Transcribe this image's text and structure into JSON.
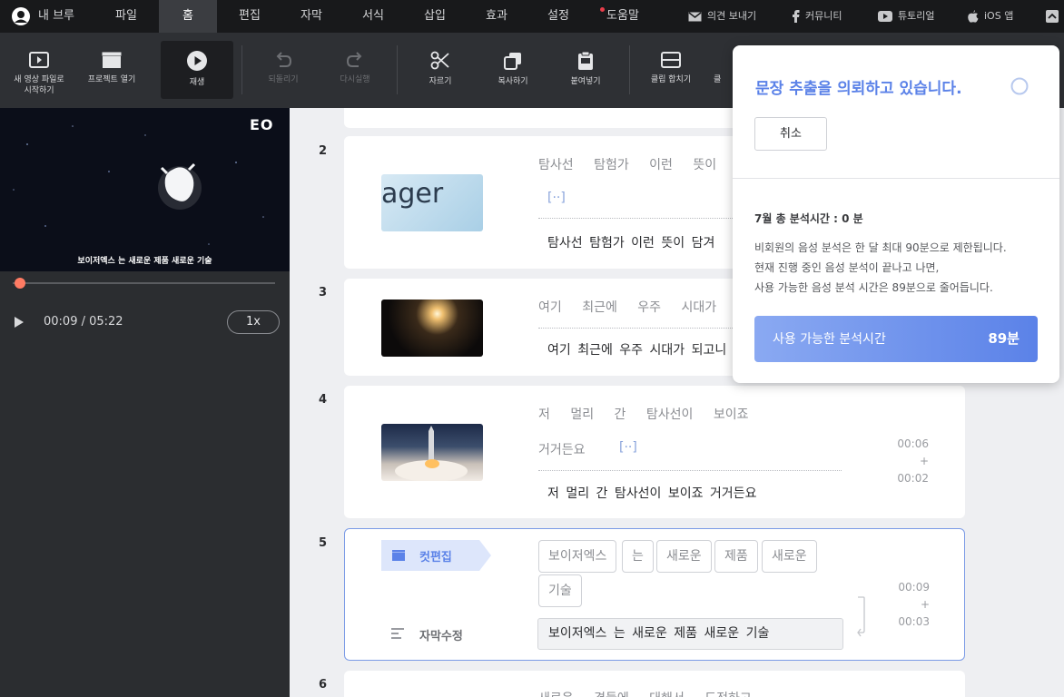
{
  "menu": {
    "user": "내 브루",
    "tabs": [
      "파일",
      "홈",
      "편집",
      "자막",
      "서식",
      "삽입",
      "효과",
      "설정",
      "도움말"
    ],
    "feedback": "의견 보내기",
    "community": "커뮤니티",
    "tutorial": "튜토리얼",
    "ios": "iOS 앱"
  },
  "toolbar": {
    "new_video": "새 영상 파일로\n시작하기",
    "open_project": "프로젝트 열기",
    "play": "재생",
    "undo": "되돌리기",
    "redo": "다시실행",
    "cut": "자르기",
    "copy": "복사하기",
    "paste": "붙여넣기",
    "merge": "클립 합치기",
    "split": "클"
  },
  "player": {
    "caption": "보이저엑스 는 새로운 제품 새로운 기술",
    "logo": "EO",
    "time": "00:09 / 05:22",
    "speed": "1x"
  },
  "clips": [
    {
      "num": "2",
      "words": "탐사선 탐험가 이런 뜻이",
      "more": "[··]",
      "sentence": "탐사선 탐험가 이런 뜻이 담겨",
      "thumb_text": "ager"
    },
    {
      "num": "3",
      "words": "여기 최근에 우주 시대가",
      "sentence": "여기 최근에 우주 시대가 되고니"
    },
    {
      "num": "4",
      "words": "저 멀리 간 탐사선이 보이죠",
      "words2": "거거든요",
      "more": "[··]",
      "sentence": "저 멀리 간 탐사선이 보이죠 거거든요",
      "start": "00:06",
      "dur": "+ 00:02"
    },
    {
      "num": "5",
      "cut_edit": "컷편집",
      "subtitle_edit": "자막수정",
      "wordboxes": [
        "보이저엑스",
        "는",
        "새로운",
        "제품",
        "새로운",
        "기술"
      ],
      "sentence": "보이저엑스 는 새로운 제품 새로운 기술",
      "start": "00:09",
      "dur": "+ 00:03"
    },
    {
      "num": "6",
      "words": "새로운 경들에 대해서 도전하고"
    }
  ],
  "popup": {
    "title": "문장 추출을 의뢰하고 있습니다.",
    "cancel": "취소",
    "usage_title": "7월 총 분석시간 : 0 분",
    "desc1": "비회원의 음성 분석은 한 달 최대 90분으로 제한됩니다.",
    "desc2": "현재 진행 중인 음성 분석이 끝나고 나면,",
    "desc3": "사용 가능한 음성 분석 시간은 89분으로 줄어듭니다.",
    "avail_label": "사용 가능한 분석시간",
    "avail_value": "89분"
  },
  "colors": {
    "accent": "#5b82e8",
    "progress": "#ff7b63",
    "menubar": "#18191b"
  }
}
